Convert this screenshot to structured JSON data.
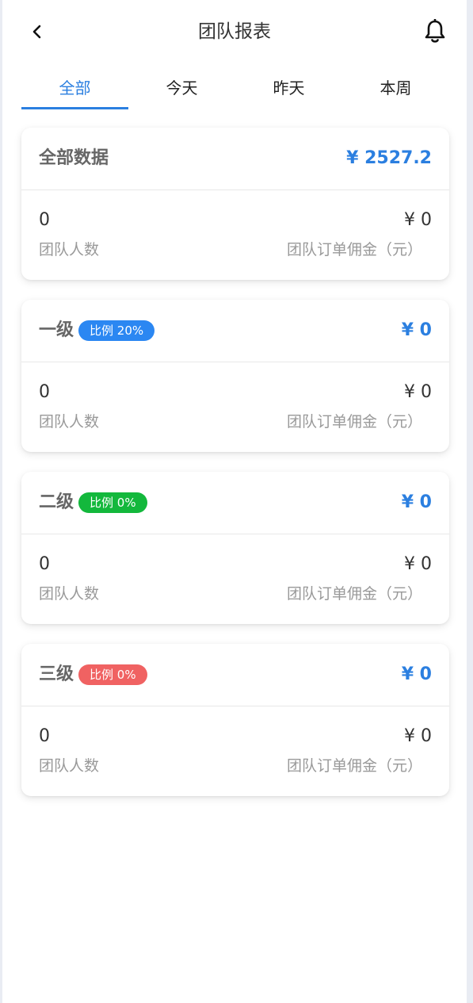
{
  "header": {
    "title": "团队报表",
    "back_icon": "chevron-left-icon",
    "notify_icon": "bell-icon"
  },
  "tabs": [
    {
      "label": "全部",
      "active": true
    },
    {
      "label": "今天",
      "active": false
    },
    {
      "label": "昨天",
      "active": false
    },
    {
      "label": "本周",
      "active": false
    }
  ],
  "colors": {
    "accent": "#2b7fe0",
    "level1_badge": "#2b87f2",
    "level2_badge": "#13b83c",
    "level3_badge": "#f06262"
  },
  "cards": [
    {
      "name": "全部数据",
      "badge": "",
      "amount": "¥ 2527.2",
      "member_count": "0",
      "commission": "¥ 0",
      "count_label": "团队人数",
      "commission_label": "团队订单佣金（元）"
    },
    {
      "name": "一级",
      "badge": "比例 20%",
      "amount": "¥ 0",
      "member_count": "0",
      "commission": "¥ 0",
      "count_label": "团队人数",
      "commission_label": "团队订单佣金（元）"
    },
    {
      "name": "二级",
      "badge": "比例 0%",
      "amount": "¥ 0",
      "member_count": "0",
      "commission": "¥ 0",
      "count_label": "团队人数",
      "commission_label": "团队订单佣金（元）"
    },
    {
      "name": "三级",
      "badge": "比例 0%",
      "amount": "¥ 0",
      "member_count": "0",
      "commission": "¥ 0",
      "count_label": "团队人数",
      "commission_label": "团队订单佣金（元）"
    }
  ]
}
